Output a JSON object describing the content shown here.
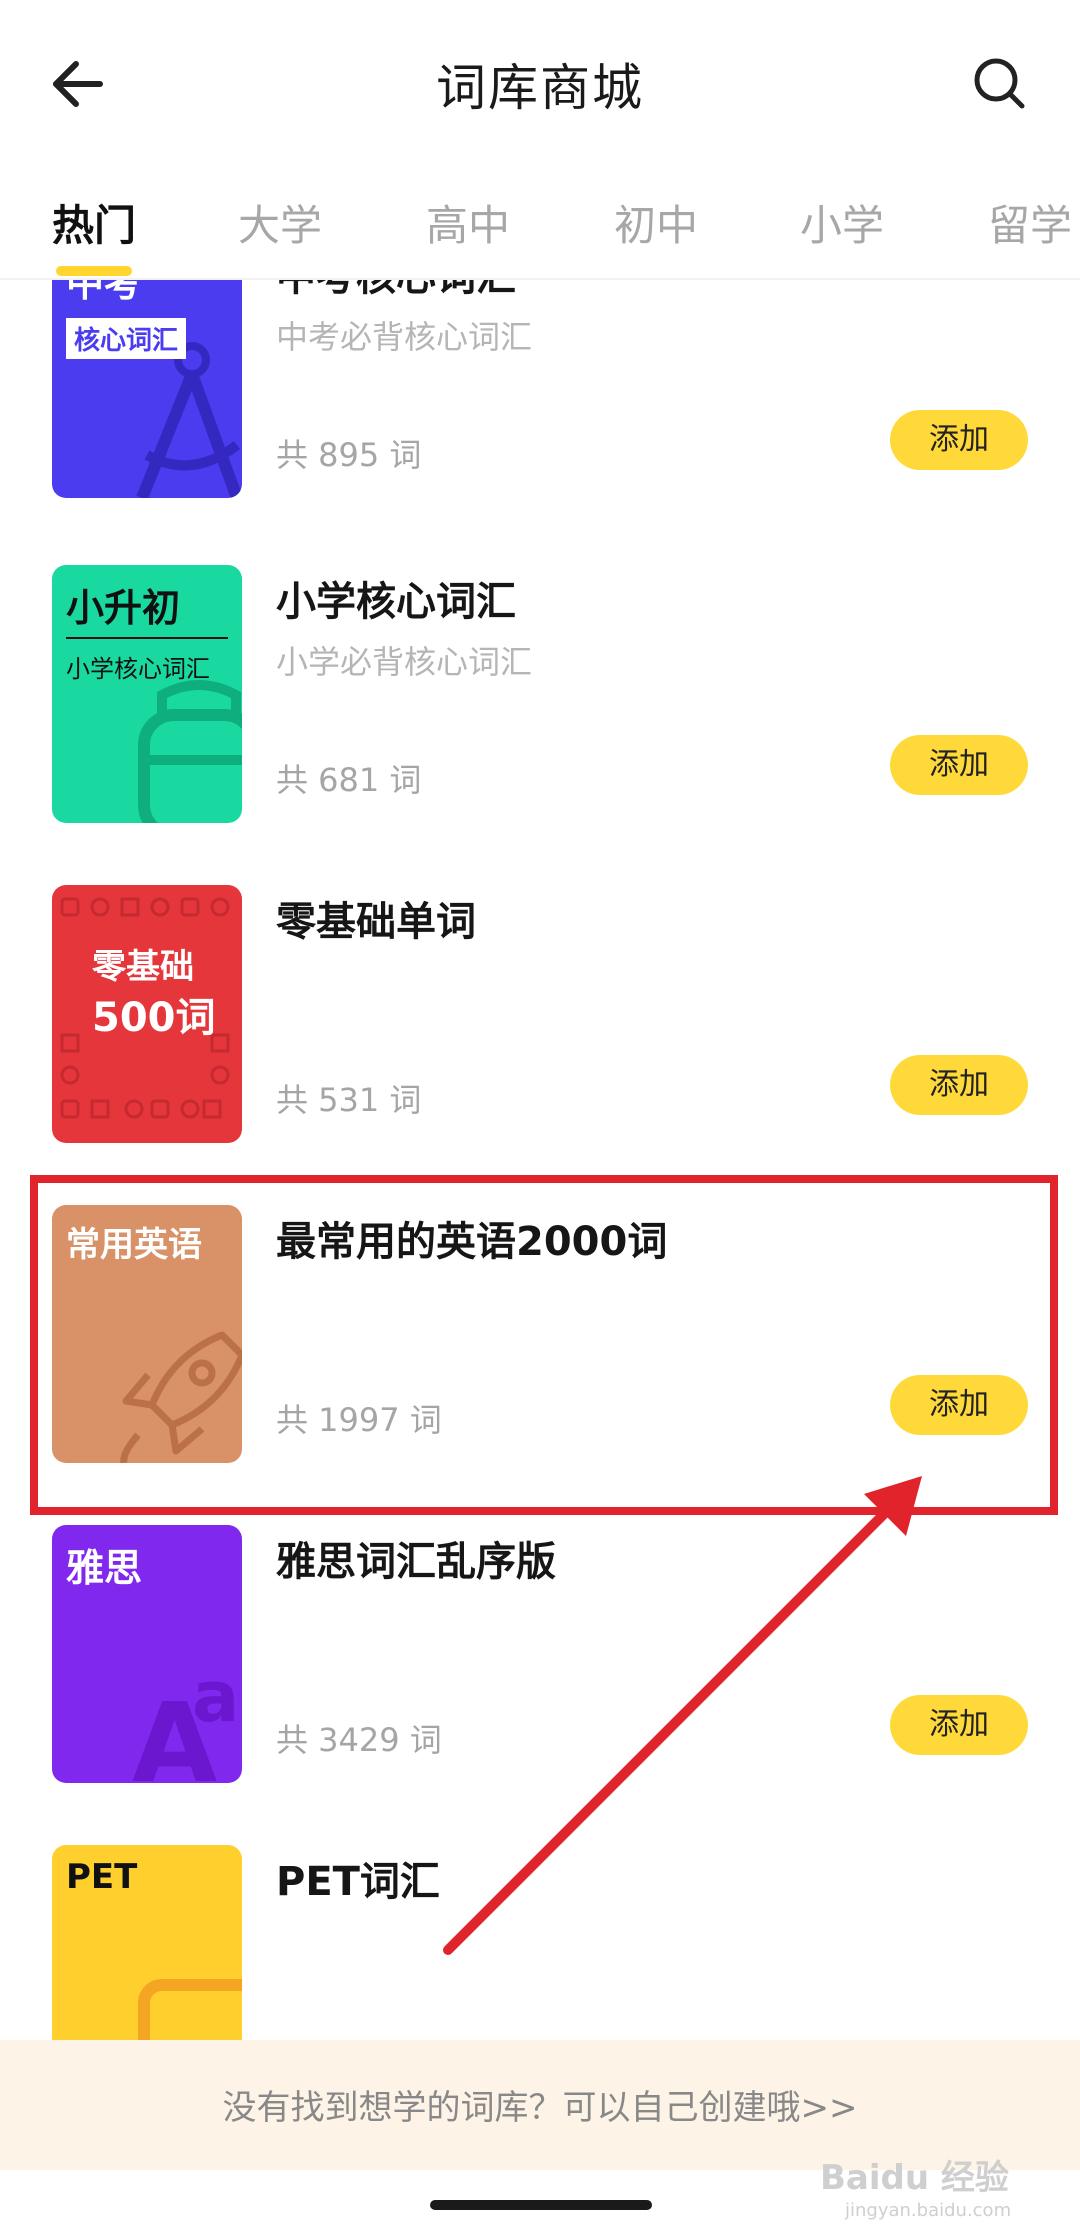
{
  "header": {
    "title": "词库商城",
    "back_icon": "arrow-left-icon",
    "search_icon": "search-icon"
  },
  "tabs": [
    {
      "label": "热门",
      "active": true
    },
    {
      "label": "大学",
      "active": false
    },
    {
      "label": "高中",
      "active": false
    },
    {
      "label": "初中",
      "active": false
    },
    {
      "label": "小学",
      "active": false
    },
    {
      "label": "留学",
      "active": false
    }
  ],
  "books": [
    {
      "cover_title": "中考",
      "cover_sub": "核心词汇",
      "cover_color": "#4b3cf0",
      "name": "中考核心词汇",
      "desc": "中考必背核心词汇",
      "count": "共 895 词",
      "button": "添加"
    },
    {
      "cover_title": "小升初",
      "cover_sub": "小学核心词汇",
      "cover_color": "#19d9a0",
      "name": "小学核心词汇",
      "desc": "小学必背核心词汇",
      "count": "共 681 词",
      "button": "添加"
    },
    {
      "cover_title": "零基础",
      "cover_sub": "500词",
      "cover_color": "#e4363b",
      "name": "零基础单词",
      "desc": "",
      "count": "共 531 词",
      "button": "添加"
    },
    {
      "cover_title": "常用英语",
      "cover_sub": "",
      "cover_color": "#d99167",
      "name": "最常用的英语2000词",
      "desc": "",
      "count": "共 1997 词",
      "button": "添加"
    },
    {
      "cover_title": "雅思",
      "cover_sub": "",
      "cover_color": "#8128ef",
      "name": "雅思词汇乱序版",
      "desc": "",
      "count": "共 3429 词",
      "button": "添加"
    },
    {
      "cover_title": "PET",
      "cover_sub": "",
      "cover_color": "#ffcf2e",
      "name": "PET词汇",
      "desc": "",
      "count": "",
      "button": ""
    }
  ],
  "footer": {
    "text": "没有找到想学的词库？可以自己创建哦>>"
  },
  "watermark": {
    "text": "Baidu 经验",
    "sub": "jingyan.baidu.com"
  },
  "colors": {
    "accent": "#ffd93a",
    "highlight": "#e1242b"
  }
}
